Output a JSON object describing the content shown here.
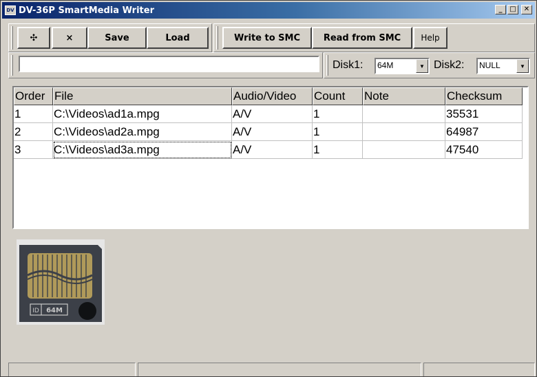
{
  "window": {
    "title": "DV-36P SmartMedia Writer",
    "app_icon_text": "DV",
    "controls": {
      "minimize": "_",
      "maximize": "□",
      "close": "✕"
    }
  },
  "toolbar": {
    "add_label": "✣",
    "remove_label": "×",
    "save_label": "Save",
    "load_label": "Load",
    "write_label": "Write to SMC",
    "read_label": "Read from SMC",
    "help_label": "Help"
  },
  "path_bar": {
    "path_value": "",
    "disk1_label": "Disk1:",
    "disk1_value": "64M",
    "disk2_label": "Disk2:",
    "disk2_value": "NULL"
  },
  "table": {
    "columns": [
      "Order",
      "File",
      "Audio/Video",
      "Count",
      "Note",
      "Checksum"
    ],
    "rows": [
      [
        "1",
        "C:\\Videos\\ad1a.mpg",
        "A/V",
        "1",
        "",
        "35531"
      ],
      [
        "2",
        "C:\\Videos\\ad2a.mpg",
        "A/V",
        "1",
        "",
        "64987"
      ],
      [
        "3",
        "C:\\Videos\\ad3a.mpg",
        "A/V",
        "1",
        "",
        "47540"
      ]
    ]
  },
  "card": {
    "label": "64M",
    "id_text": "ID"
  },
  "colors": {
    "title_start": "#0a246a",
    "title_end": "#a6caf0",
    "face": "#d4d0c8",
    "card_body": "#3c4048",
    "card_contacts": "#b09a5a"
  }
}
